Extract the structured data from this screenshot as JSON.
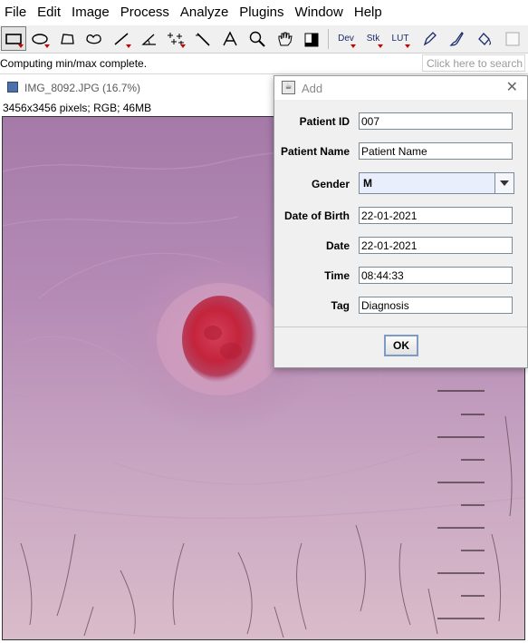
{
  "menu": [
    "File",
    "Edit",
    "Image",
    "Process",
    "Analyze",
    "Plugins",
    "Window",
    "Help"
  ],
  "toolbar": {
    "text_tools": {
      "dev": "Dev",
      "stk": "Stk",
      "lut": "LUT"
    }
  },
  "status": {
    "message": "Computing min/max complete.",
    "search_placeholder": "Click here to search"
  },
  "image_window": {
    "title": "IMG_8092.JPG (16.7%)",
    "info": "3456x3456 pixels; RGB; 46MB"
  },
  "dialog": {
    "title": "Add",
    "fields": {
      "patient_id": {
        "label": "Patient ID",
        "value": "007"
      },
      "patient_name": {
        "label": "Patient Name",
        "value": "Patient Name"
      },
      "gender": {
        "label": "Gender",
        "value": "M"
      },
      "dob": {
        "label": "Date of Birth",
        "value": "22-01-2021"
      },
      "date": {
        "label": "Date",
        "value": "22-01-2021"
      },
      "time": {
        "label": "Time",
        "value": "08:44:33"
      },
      "tag": {
        "label": "Tag",
        "value": "Diagnosis"
      }
    },
    "ok_label": "OK"
  },
  "colors": {
    "skin": "#b48fb4",
    "lesion": "#c4243c",
    "ok_border": "#7d9bc4",
    "tool_text": "#1a2a6c"
  }
}
